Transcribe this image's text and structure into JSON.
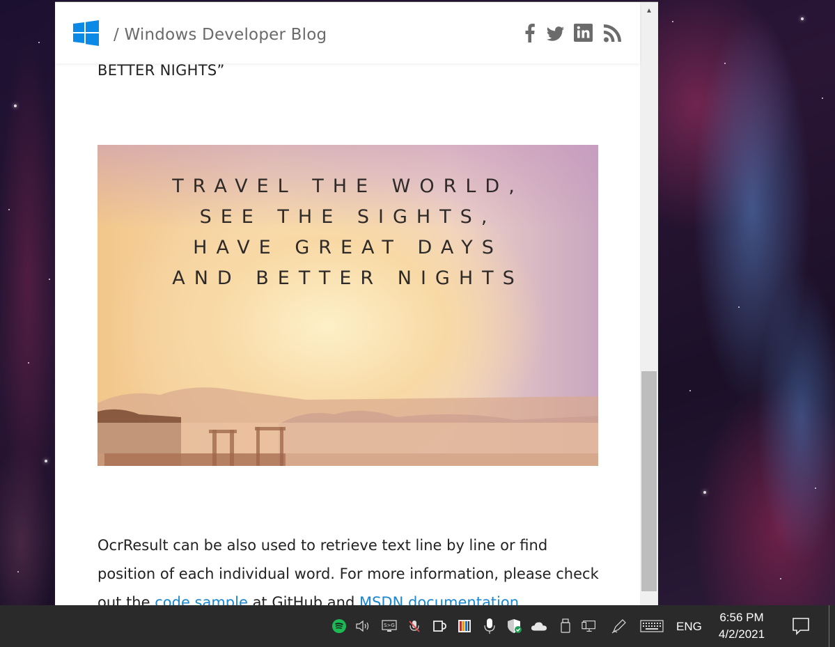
{
  "header": {
    "blog_title": "/ Windows Developer Blog",
    "social_icons": [
      "facebook-icon",
      "twitter-icon",
      "linkedin-icon",
      "rss-icon"
    ]
  },
  "article": {
    "previous_text": "BETTER NIGHTS”",
    "image_quote_lines": [
      "TRAVEL THE WORLD,",
      "SEE THE SIGHTS,",
      "HAVE GREAT DAYS",
      "AND BETTER NIGHTS"
    ],
    "paragraph": {
      "text_before": "OcrResult can be also used to retrieve text line by line or find position of each individual word. For more information, please check out the ",
      "link1": "code sample",
      "text_middle": " at GitHub and ",
      "link2": "MSDN documentation"
    }
  },
  "taskbar": {
    "language": "ENG",
    "time": "6:56 PM",
    "date": "4/2/2021",
    "tray_icons": [
      "spotify-icon",
      "volume-icon",
      "display-icon",
      "microphone-muted-icon",
      "coffee-icon",
      "app-icon",
      "microphone-icon",
      "security-icon",
      "onedrive-icon",
      "usb-icon",
      "network-icon",
      "pen-icon",
      "keyboard-icon"
    ]
  },
  "colors": {
    "accent": "#0a8ae6",
    "link": "#1a86d0",
    "taskbar": "#2a2a2a"
  }
}
